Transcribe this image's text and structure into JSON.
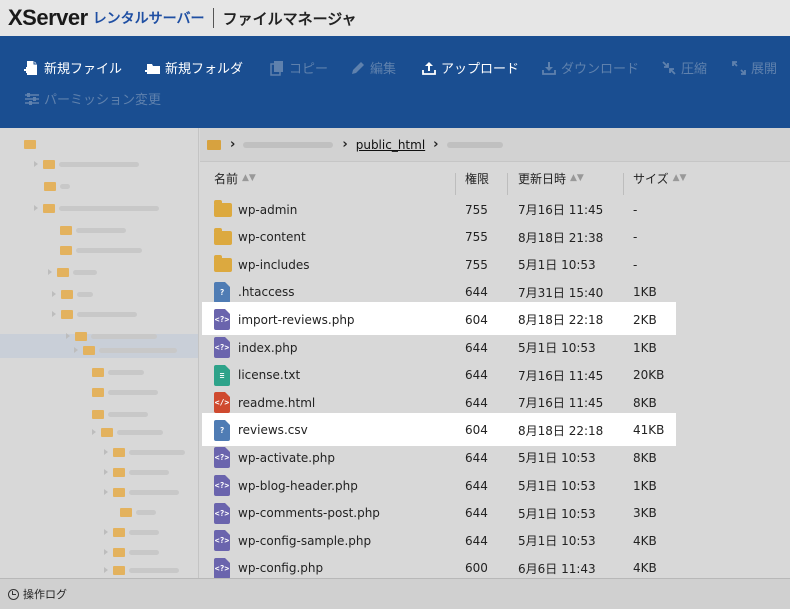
{
  "header": {
    "logo_x": "XServer",
    "logo_rental": "レンタルサーバー",
    "title": "ファイルマネージャ"
  },
  "toolbar": {
    "items": [
      {
        "label": "新規ファイル",
        "icon": "new-file-icon",
        "enabled": true
      },
      {
        "label": "新規フォルダ",
        "icon": "new-folder-icon",
        "enabled": true
      },
      {
        "label": "コピー",
        "icon": "copy-icon",
        "enabled": false
      },
      {
        "label": "編集",
        "icon": "pencil-icon",
        "enabled": false
      },
      {
        "label": "アップロード",
        "icon": "upload-icon",
        "enabled": true
      },
      {
        "label": "ダウンロード",
        "icon": "download-icon",
        "enabled": false
      },
      {
        "label": "圧縮",
        "icon": "compress-icon",
        "enabled": false
      },
      {
        "label": "展開",
        "icon": "extract-icon",
        "enabled": false
      },
      {
        "label": "パーミッション変更",
        "icon": "permission-icon",
        "enabled": false
      }
    ]
  },
  "breadcrumb": {
    "current": "public_html"
  },
  "table": {
    "headers": {
      "name": "名前",
      "perm": "権限",
      "date": "更新日時",
      "size": "サイズ"
    },
    "rows": [
      {
        "name": "wp-admin",
        "perm": "755",
        "date": "7月16日 11:45",
        "size": "-",
        "type": "folder"
      },
      {
        "name": "wp-content",
        "perm": "755",
        "date": "8月18日 21:38",
        "size": "-",
        "type": "folder"
      },
      {
        "name": "wp-includes",
        "perm": "755",
        "date": "5月1日 10:53",
        "size": "-",
        "type": "folder"
      },
      {
        "name": ".htaccess",
        "perm": "644",
        "date": "7月31日 15:40",
        "size": "1KB",
        "type": "unknown"
      },
      {
        "name": "import-reviews.php",
        "perm": "604",
        "date": "8月18日 22:18",
        "size": "2KB",
        "type": "php",
        "highlight": true
      },
      {
        "name": "index.php",
        "perm": "644",
        "date": "5月1日 10:53",
        "size": "1KB",
        "type": "php"
      },
      {
        "name": "license.txt",
        "perm": "644",
        "date": "7月16日 11:45",
        "size": "20KB",
        "type": "txt"
      },
      {
        "name": "readme.html",
        "perm": "644",
        "date": "7月16日 11:45",
        "size": "8KB",
        "type": "html"
      },
      {
        "name": "reviews.csv",
        "perm": "604",
        "date": "8月18日 22:18",
        "size": "41KB",
        "type": "unknown",
        "highlight": true
      },
      {
        "name": "wp-activate.php",
        "perm": "644",
        "date": "5月1日 10:53",
        "size": "8KB",
        "type": "php"
      },
      {
        "name": "wp-blog-header.php",
        "perm": "644",
        "date": "5月1日 10:53",
        "size": "1KB",
        "type": "php"
      },
      {
        "name": "wp-comments-post.php",
        "perm": "644",
        "date": "5月1日 10:53",
        "size": "3KB",
        "type": "php"
      },
      {
        "name": "wp-config-sample.php",
        "perm": "644",
        "date": "5月1日 10:53",
        "size": "4KB",
        "type": "php"
      },
      {
        "name": "wp-config.php",
        "perm": "600",
        "date": "6月6日 11:43",
        "size": "4KB",
        "type": "php"
      }
    ]
  },
  "status": {
    "log_label": "操作ログ"
  },
  "colors": {
    "toolbar_bg": "#1a4e91",
    "toolbar_text": "#ffffff",
    "toolbar_disabled": "#5f81ad",
    "folder": "#dca93f",
    "php_icon": "#6a64ad",
    "unknown_icon": "#4f7cb4",
    "txt_icon": "#2ea38a",
    "html_icon": "#cf4a2f",
    "highlight": "#ffffff"
  }
}
